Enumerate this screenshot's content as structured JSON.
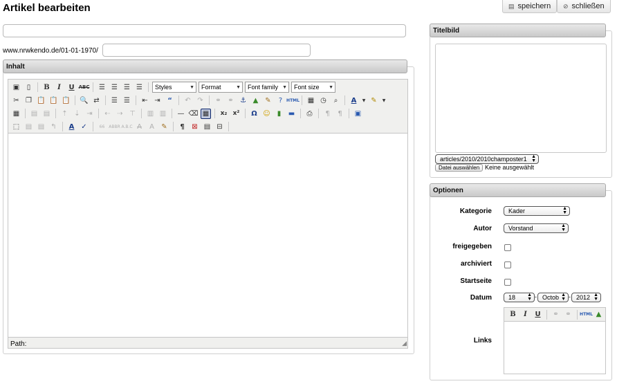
{
  "page": {
    "title": "Artikel bearbeiten"
  },
  "actions": {
    "save_label": "speichern",
    "close_label": "schließen",
    "save_icon": "floppy-icon",
    "close_icon": "cancel-icon"
  },
  "article": {
    "title_value": "",
    "url_prefix": "www.nrwkendo.de/01-01-1970/",
    "slug_value": ""
  },
  "content_panel": {
    "title": "Inhalt",
    "styles_placeholder": "Styles",
    "format_placeholder": "Format",
    "font_family_placeholder": "Font family",
    "font_size_placeholder": "Font size",
    "path_label": "Path:"
  },
  "image_panel": {
    "title": "Titelbild",
    "image_select_value": "articles/2010/2010champoster1",
    "file_button_label": "Datei auswählen",
    "file_status": "Keine ausgewählt"
  },
  "options_panel": {
    "title": "Optionen",
    "category_label": "Kategorie",
    "category_value": "Kader",
    "author_label": "Autor",
    "author_value": "Vorstand",
    "released_label": "freigegeben",
    "archived_label": "archiviert",
    "startpage_label": "Startseite",
    "date_label": "Datum",
    "day_value": "18",
    "month_value": "Octob",
    "year_value": "2012",
    "links_label": "Links"
  }
}
